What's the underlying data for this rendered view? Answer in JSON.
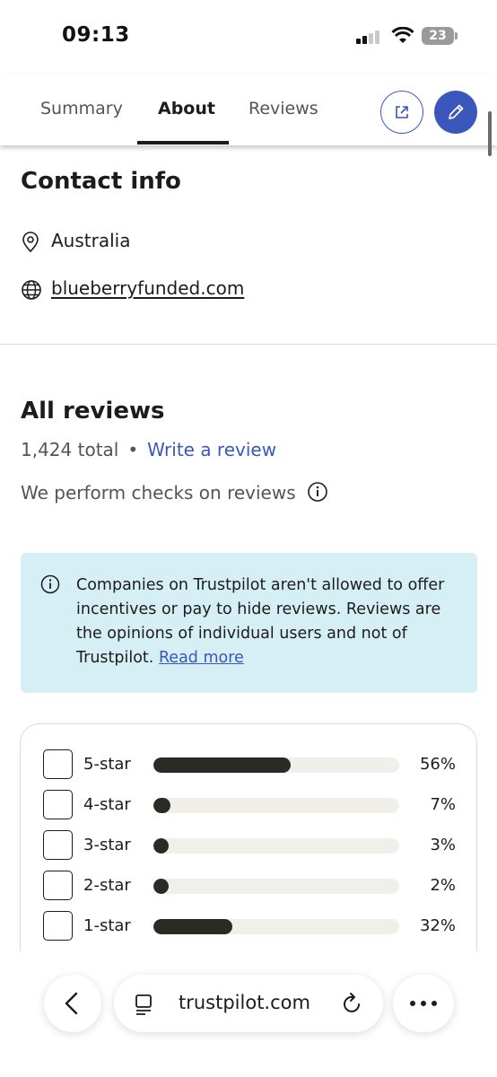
{
  "status_bar": {
    "time": "09:13",
    "battery": "23"
  },
  "tabs": [
    {
      "label": "Summary",
      "active": false
    },
    {
      "label": "About",
      "active": true
    },
    {
      "label": "Reviews",
      "active": false
    }
  ],
  "colors": {
    "accent": "#3c57bc",
    "bar_fill": "#2b2b26",
    "bar_track": "#f1efea",
    "notice_bg": "#d6eff5"
  },
  "contact": {
    "title": "Contact info",
    "location": "Australia",
    "website": "blueberryfunded.com",
    "location_icon": "map-pin-icon",
    "website_icon": "globe-icon"
  },
  "reviews": {
    "title": "All reviews",
    "total": "1,424 total",
    "separator": "•",
    "write_review": "Write a review",
    "checks_text": "We perform checks on reviews"
  },
  "notice": {
    "text": "Companies on Trustpilot aren't allowed to offer incentives or pay to hide reviews. Reviews are the opinions of individual users and not of Trustpilot.",
    "link": "Read more"
  },
  "rating_distribution": [
    {
      "label": "5-star",
      "percent": "56%",
      "fraction": 0.56
    },
    {
      "label": "4-star",
      "percent": "7%",
      "fraction": 0.07
    },
    {
      "label": "3-star",
      "percent": "3%",
      "fraction": 0.03
    },
    {
      "label": "2-star",
      "percent": "2%",
      "fraction": 0.02
    },
    {
      "label": "1-star",
      "percent": "32%",
      "fraction": 0.32
    }
  ],
  "browser": {
    "url": "trustpilot.com"
  }
}
